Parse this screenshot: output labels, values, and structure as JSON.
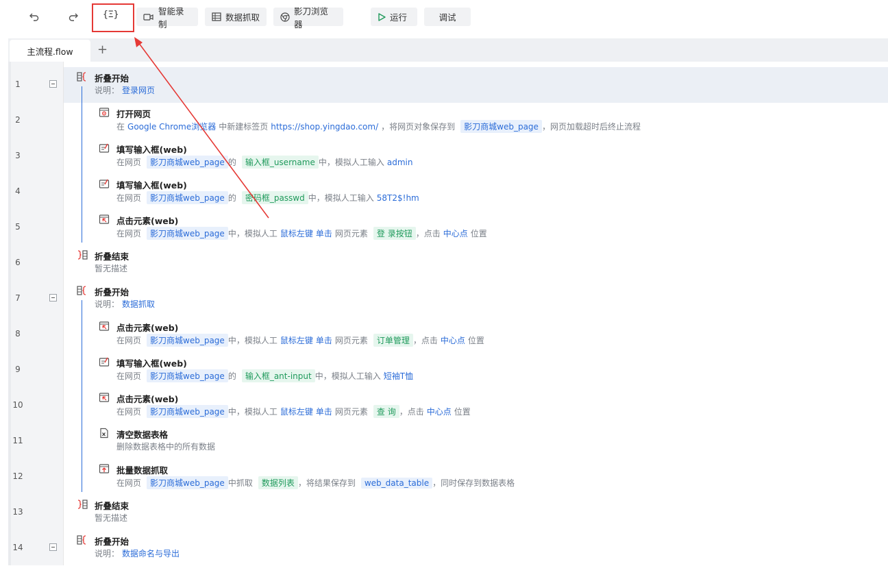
{
  "toolbar": {
    "undo_icon": "undo-icon",
    "redo_icon": "redo-icon",
    "code_label": "{Ξ}",
    "smart_record": "智能录制",
    "data_capture": "数据抓取",
    "browser": "影刀浏览器",
    "run": "运行",
    "debug": "调试"
  },
  "tabs": [
    {
      "label": "主流程.flow"
    }
  ],
  "tab_add": "+",
  "rows": [
    {
      "ln": "1",
      "title": "折叠开始",
      "d": [
        "说明：",
        "登录网页"
      ]
    },
    {
      "ln": "2",
      "title": "打开网页",
      "d": [
        "在",
        "Google Chrome浏览器",
        "中新建标签页",
        "https://shop.yingdao.com/",
        "，将网页对象保存到",
        "影刀商城web_page",
        "，网页加载超时后终止流程"
      ]
    },
    {
      "ln": "3",
      "title": "填写输入框(web)",
      "d": [
        "在网页",
        "影刀商城web_page",
        "的",
        "输入框_username",
        "中，模拟人工输入",
        "admin"
      ]
    },
    {
      "ln": "4",
      "title": "填写输入框(web)",
      "d": [
        "在网页",
        "影刀商城web_page",
        "的",
        "密码框_passwd",
        "中，模拟人工输入",
        "58T2$!hm"
      ]
    },
    {
      "ln": "5",
      "title": "点击元素(web)",
      "d": [
        "在网页",
        "影刀商城web_page",
        "中，模拟人工",
        "鼠标左键",
        "单击",
        "网页元素",
        "登 录按钮",
        "，点击",
        "中心点",
        "位置"
      ]
    },
    {
      "ln": "6",
      "title": "折叠结束",
      "d": [
        "暂无描述"
      ]
    },
    {
      "ln": "7",
      "title": "折叠开始",
      "d": [
        "说明：",
        "数据抓取"
      ]
    },
    {
      "ln": "8",
      "title": "点击元素(web)",
      "d": [
        "在网页",
        "影刀商城web_page",
        "中，模拟人工",
        "鼠标左键",
        "单击",
        "网页元素",
        "订单管理",
        "，点击",
        "中心点",
        "位置"
      ]
    },
    {
      "ln": "9",
      "title": "填写输入框(web)",
      "d": [
        "在网页",
        "影刀商城web_page",
        "的",
        "输入框_ant-input",
        "中，模拟人工输入",
        "短袖T恤"
      ]
    },
    {
      "ln": "10",
      "title": "点击元素(web)",
      "d": [
        "在网页",
        "影刀商城web_page",
        "中，模拟人工",
        "鼠标左键",
        "单击",
        "网页元素",
        "查 询",
        "，点击",
        "中心点",
        "位置"
      ]
    },
    {
      "ln": "11",
      "title": "清空数据表格",
      "d": [
        "删除数据表格中的所有数据"
      ]
    },
    {
      "ln": "12",
      "title": "批量数据抓取",
      "d": [
        "在网页",
        "影刀商城web_page",
        "中抓取",
        "数据列表",
        "，将结果保存到",
        "web_data_table",
        "，同时保存到数据表格"
      ]
    },
    {
      "ln": "13",
      "title": "折叠结束",
      "d": [
        "暂无描述"
      ]
    },
    {
      "ln": "14",
      "title": "折叠开始",
      "d": [
        "说明：",
        "数据命名与导出"
      ]
    }
  ],
  "colors": {
    "accent": "#2b6cd8",
    "highlight": "#e53935",
    "green": "#1f9a5b"
  }
}
